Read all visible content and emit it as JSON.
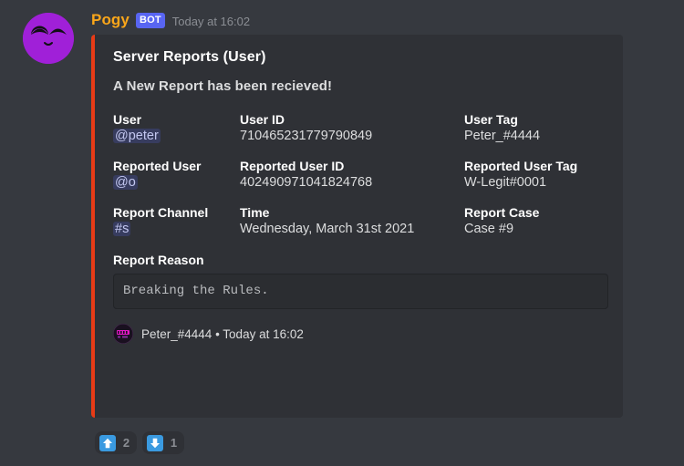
{
  "message": {
    "author": "Pogy",
    "bot_badge": "BOT",
    "timestamp": "Today at 16:02",
    "avatar_color": "#a020d8",
    "username_color": "#faa61a",
    "bot_badge_color": "#5865f2"
  },
  "embed": {
    "accent_color": "#e83b16",
    "title": "Server Reports (User)",
    "description": "A New Report has been recieved!",
    "fields": [
      {
        "name": "User",
        "value": "@peter",
        "is_mention": true
      },
      {
        "name": "User ID",
        "value": "710465231779790849",
        "is_mention": false
      },
      {
        "name": "User Tag",
        "value": "Peter_#4444",
        "is_mention": false
      },
      {
        "name": "Reported User",
        "value": "@o",
        "is_mention": true
      },
      {
        "name": "Reported User ID",
        "value": "402490971041824768",
        "is_mention": false
      },
      {
        "name": "Reported User Tag",
        "value": "W-Legit#0001",
        "is_mention": false
      },
      {
        "name": "Report Channel",
        "value": "#s",
        "is_mention": true
      },
      {
        "name": "Time",
        "value": "Wednesday, March 31st 2021",
        "is_mention": false
      },
      {
        "name": "Report Case",
        "value": "Case #9",
        "is_mention": false
      }
    ],
    "reason": {
      "name": "Report Reason",
      "value": "Breaking the Rules."
    },
    "footer": {
      "text": "Peter_#4444 • Today at 16:02",
      "icon": "footer-avatar-icon"
    }
  },
  "reactions": [
    {
      "emoji": "upvote-arrow-icon",
      "count": "2"
    },
    {
      "emoji": "downvote-arrow-icon",
      "count": "1"
    }
  ]
}
